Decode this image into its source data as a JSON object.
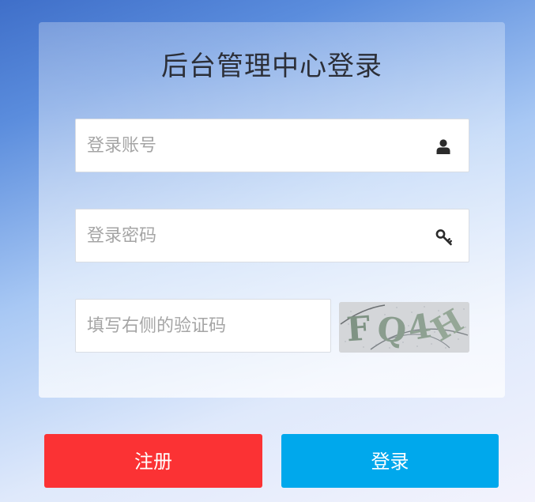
{
  "login": {
    "title": "后台管理中心登录",
    "account_placeholder": "登录账号",
    "password_placeholder": "登录密码",
    "captcha_placeholder": "填写右侧的验证码",
    "captcha_text": "FQ4H",
    "register_label": "注册",
    "login_label": "登录"
  },
  "icons": {
    "account": "user-icon",
    "password": "key-icon"
  },
  "colors": {
    "register_button": "#fb3234",
    "login_button": "#00a8ec",
    "title_text": "#2c2f38",
    "placeholder_text": "#a5a5a5"
  }
}
